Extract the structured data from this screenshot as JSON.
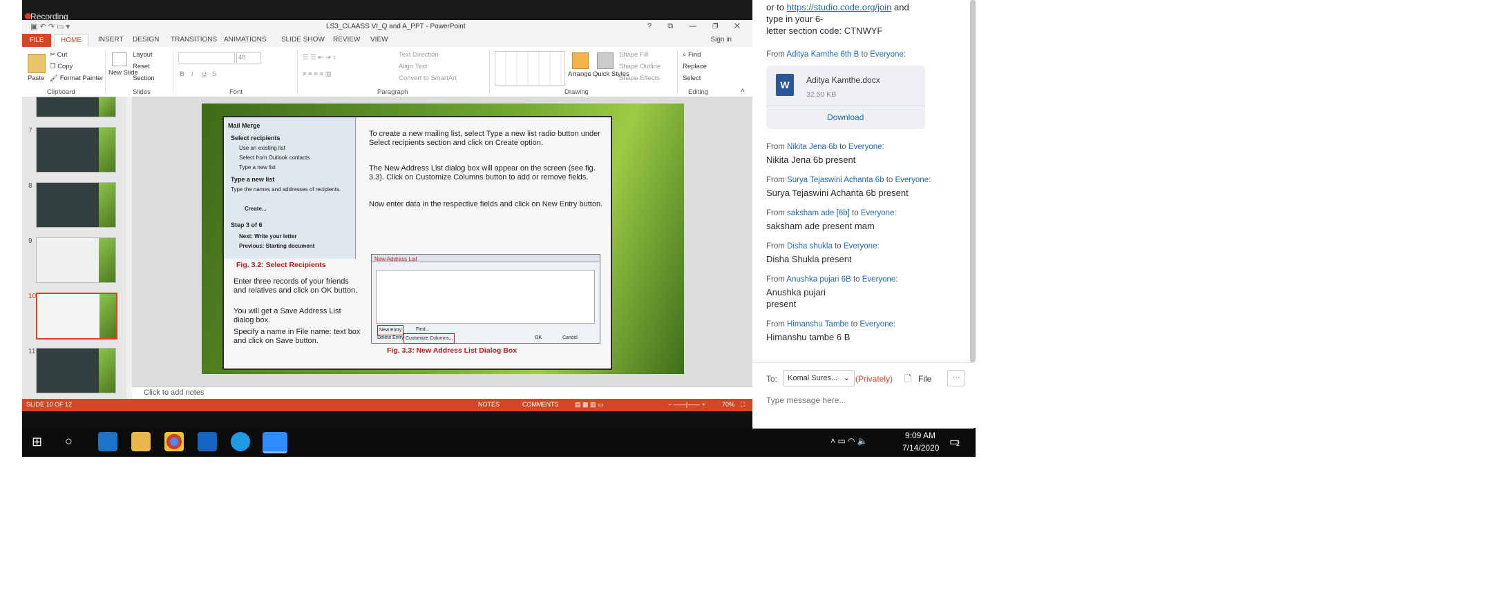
{
  "recording": {
    "label": "Recording"
  },
  "window": {
    "title": "LS3_CLAASS VI_Q and A_PPT - PowerPoint",
    "controls": "? ⧉ — ❐ ✕"
  },
  "ribbon_tabs": [
    "FILE",
    "HOME",
    "INSERT",
    "DESIGN",
    "TRANSITIONS",
    "ANIMATIONS",
    "SLIDE SHOW",
    "REVIEW",
    "VIEW"
  ],
  "signin": "Sign in",
  "ribbon": {
    "clipboard": {
      "group": "Clipboard",
      "paste": "Paste",
      "cut": "Cut",
      "copy": "Copy",
      "format_painter": "Format Painter"
    },
    "slides": {
      "group": "Slides",
      "new_slide": "New Slide",
      "layout": "Layout",
      "reset": "Reset",
      "section": "Section"
    },
    "font": {
      "group": "Font",
      "size": "48"
    },
    "paragraph": {
      "group": "Paragraph",
      "text_direction": "Text Direction",
      "align_text": "Align Text",
      "convert": "Convert to SmartArt"
    },
    "drawing": {
      "group": "Drawing",
      "arrange": "Arrange",
      "quick_styles": "Quick Styles",
      "shape_fill": "Shape Fill",
      "shape_outline": "Shape Outline",
      "shape_effects": "Shape Effects"
    },
    "editing": {
      "group": "Editing",
      "find": "Find",
      "replace": "Replace",
      "select": "Select"
    }
  },
  "thumbnails": [
    "7",
    "8",
    "9",
    "10",
    "11"
  ],
  "slide": {
    "dialog_title": "Mail Merge",
    "select_recipients": "Select recipients",
    "use_existing": "Use an existing list",
    "select_outlook": "Select from Outlook contacts",
    "type_new": "Type a new list",
    "type_new_head": "Type a new list",
    "type_names": "Type the names and addresses of recipients.",
    "create": "Create...",
    "step": "Step 3 of 6",
    "next": "Next: Write your letter",
    "previous": "Previous: Starting document",
    "fig32": "Fig. 3.2: Select Recipients",
    "p1": "To create a new mailing list, select Type a new list radio button under Select recipients section and click on Create option.",
    "p2": "The New Address List dialog box will appear on the screen (see fig. 3.3). Click on Customize Columns button to add or remove fields.",
    "p3": "Now enter data in the respective fields and click on New Entry button.",
    "l1": "Enter three records of your friends and relatives and click on OK button.",
    "l2": "You will get a Save Address List dialog box.",
    "l3": "Specify a name in File name: text box and click on Save button.",
    "fig_dialog_title": "New Address List",
    "fig_new_entry": "New Entry",
    "fig_delete_entry": "Delete Entry",
    "fig_find": "Find...",
    "fig_customize": "Customize Columns...",
    "fig_ok": "OK",
    "fig_cancel": "Cancel",
    "fig33": "Fig. 3.3: New Address List Dialog Box"
  },
  "notes_placeholder": "Click to add notes",
  "status": {
    "slide": "SLIDE 10 OF 12",
    "notes": "NOTES",
    "comments": "COMMENTS",
    "zoom": "70%"
  },
  "taskbar": {
    "time": "9:09 AM",
    "date": "7/14/2020",
    "notif_count": "2"
  },
  "chat": {
    "intro_prefix": "or to ",
    "intro_link": "https://studio.code.org/join",
    "intro_suffix": " and",
    "intro_line2": "type in your 6-",
    "intro_line3": "letter section code: CTNWYF",
    "messages": [
      {
        "from": "Aditya Kamthe 6th B",
        "to": "Everyone",
        "text": ""
      },
      {
        "from": "Nikita Jena 6b",
        "to": "Everyone",
        "text": "Nikita Jena 6b present"
      },
      {
        "from": "Surya Tejaswini Achanta 6b",
        "to": "Everyone",
        "text": "Surya Tejaswini Achanta 6b present"
      },
      {
        "from": "saksham ade [6b]",
        "to": "Everyone",
        "text": "saksham ade present mam"
      },
      {
        "from": "Disha shukla",
        "to": "Everyone",
        "text": "Disha Shukla present"
      },
      {
        "from": "Anushka pujari 6B",
        "to": "Everyone",
        "text": "Anushka pujari"
      },
      {
        "from": "Himanshu Tambe",
        "to": "Everyone",
        "text": "Himanshu tambe 6 B"
      }
    ],
    "from_word": "From",
    "to_word": "to",
    "msg6_line2": "present",
    "file": {
      "name": "Aditya Kamthe.docx",
      "size": "32.50 KB",
      "download": "Download"
    },
    "compose": {
      "to_label": "To:",
      "recipient": "Komal Sures...",
      "privately": "(Privately)",
      "file": "File",
      "more": "···",
      "placeholder": "Type message here..."
    }
  }
}
